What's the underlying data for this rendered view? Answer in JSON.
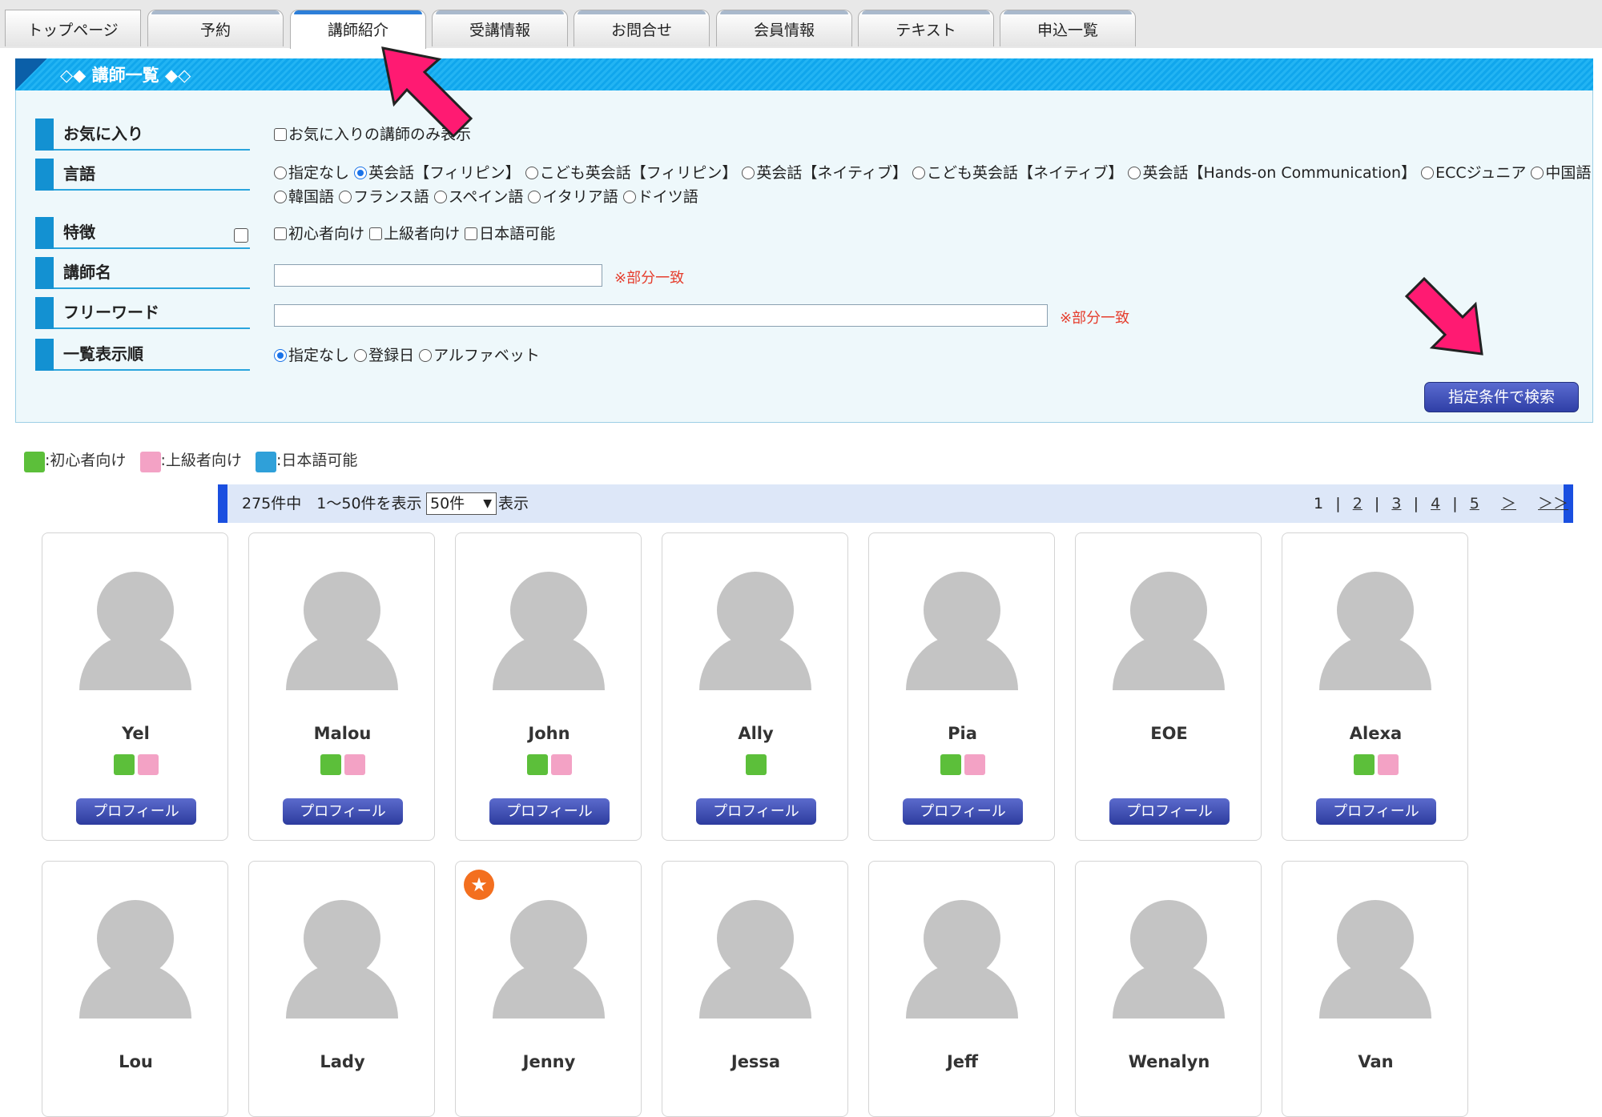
{
  "tabs": [
    "トップページ",
    "予約",
    "講師紹介",
    "受講情報",
    "お問合せ",
    "会員情報",
    "テキスト",
    "申込一覧"
  ],
  "section_title": "◇◆ 講師一覧 ◆◇",
  "filters": {
    "favorite": {
      "label": "お気に入り",
      "option": "お気に入りの講師のみ表示"
    },
    "language": {
      "label": "言語",
      "options": [
        "指定なし",
        "英会話【フィリピン】",
        "こども英会話【フィリピン】",
        "英会話【ネイティブ】",
        "こども英会話【ネイティブ】",
        "英会話【Hands-on Communication】",
        "ECCジュニア",
        "中国語",
        "韓国語",
        "フランス語",
        "スペイン語",
        "イタリア語",
        "ドイツ語"
      ],
      "selected": "英会話【フィリピン】"
    },
    "features": {
      "label": "特徴",
      "options": [
        "初心者向け",
        "上級者向け",
        "日本語可能"
      ]
    },
    "teacher_name": {
      "label": "講師名",
      "note": "※部分一致",
      "value": ""
    },
    "free_word": {
      "label": "フリーワード",
      "note": "※部分一致",
      "value": ""
    },
    "sort": {
      "label": "一覧表示順",
      "options": [
        "指定なし",
        "登録日",
        "アルファベット"
      ],
      "selected": "指定なし"
    }
  },
  "search_button": "指定条件で検索",
  "legend": {
    "beginner": ":初心者向け",
    "advanced": ":上級者向け",
    "japanese": ":日本語可能"
  },
  "results": {
    "summary": "275件中　1〜50件を表示",
    "per_page": "50件",
    "per_page_suffix": "表示",
    "pages": [
      "1",
      "2",
      "3",
      "4",
      "5",
      "＞",
      "＞＞"
    ],
    "current_page": "1"
  },
  "profile_button": "プロフィール",
  "teachers": [
    {
      "name": "Yel",
      "badges": [
        "green",
        "pink"
      ]
    },
    {
      "name": "Malou",
      "badges": [
        "green",
        "pink"
      ]
    },
    {
      "name": "John",
      "badges": [
        "green",
        "pink"
      ]
    },
    {
      "name": "Ally",
      "badges": [
        "green"
      ]
    },
    {
      "name": "Pia",
      "badges": [
        "green",
        "pink"
      ]
    },
    {
      "name": "EOE",
      "badges": []
    },
    {
      "name": "Alexa",
      "badges": [
        "green",
        "pink"
      ]
    },
    {
      "name": "Lou",
      "badges": []
    },
    {
      "name": "Lady",
      "badges": []
    },
    {
      "name": "Jenny",
      "badges": [],
      "favorite": true
    },
    {
      "name": "Jessa",
      "badges": []
    },
    {
      "name": "Jeff",
      "badges": []
    },
    {
      "name": "Wenalyn",
      "badges": []
    },
    {
      "name": "Van",
      "badges": []
    }
  ],
  "colors": {
    "accent": "#1391d2",
    "highlight_arrow": "#ff1a72",
    "button": "#2f3fa6"
  }
}
